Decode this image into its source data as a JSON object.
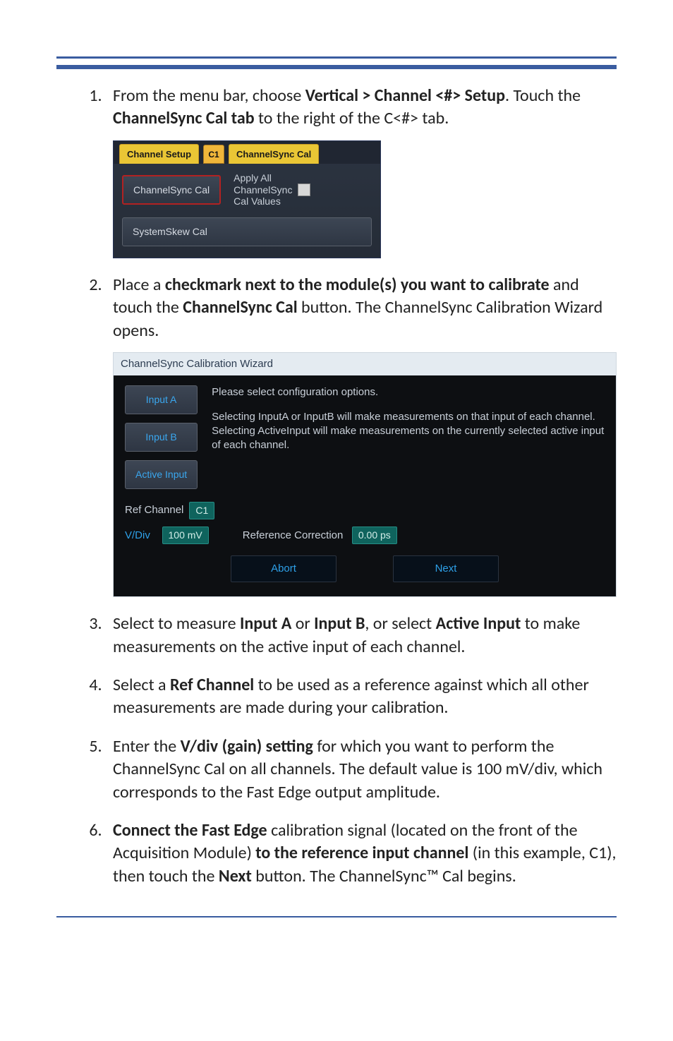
{
  "step1": {
    "prefix": "From the menu bar, choose ",
    "bold1": "Vertical > Channel <#> Setup",
    "mid": ". Touch the ",
    "bold2": "ChannelSync Cal tab",
    "suffix": " to the right of the C<#> tab."
  },
  "shot1": {
    "tab_channel_setup": "Channel Setup",
    "tab_c1": "C1",
    "tab_cscal": "ChannelSync Cal",
    "btn_cscal": "ChannelSync Cal",
    "chk_label1": "Apply All",
    "chk_label2": "ChannelSync",
    "chk_label3": "Cal Values",
    "btn_syscal": "SystemSkew Cal"
  },
  "step2": {
    "prefix": "Place a ",
    "bold1": "checkmark next to the module(s) you want to calibrate",
    "mid1": " and touch the ",
    "bold2": "ChannelSync Cal",
    "suffix": " button. The ChannelSync Calibration Wizard opens."
  },
  "shot2": {
    "title": "ChannelSync Calibration Wizard",
    "btn_input_a": "Input A",
    "btn_input_b": "Input B",
    "btn_active_input": "Active Input",
    "txt_line1": "Please select configuration options.",
    "txt_line2": "Selecting InputA or InputB will make measurements on that input of each channel.",
    "txt_line3": "Selecting ActiveInput will make measurements on the currently selected active input of each channel.",
    "ref_channel_label": "Ref Channel",
    "ref_channel_value": "C1",
    "vdiv_label": "V/Div",
    "vdiv_value": "100 mV",
    "refcorr_label": "Reference Correction",
    "refcorr_value": "0.00 ps",
    "btn_abort": "Abort",
    "btn_next": "Next"
  },
  "step3": {
    "prefix": "Select to measure ",
    "bold1": "Input A",
    "mid1": " or ",
    "bold2": "Input B",
    "mid2": ", or select ",
    "bold3": "Active Input",
    "suffix": " to make measurements on the active input of each channel."
  },
  "step4": {
    "prefix": "Select a ",
    "bold1": "Ref Channel",
    "suffix": " to be used as a reference against which all other measurements are made during your calibration."
  },
  "step5": {
    "prefix": "Enter the ",
    "bold1": "V/div (gain) setting",
    "suffix": " for which you want to perform the ChannelSync Cal on all channels.  The default value is 100 mV/div, which corresponds to the Fast Edge output amplitude."
  },
  "step6": {
    "bold1": "Connect the Fast Edge",
    "mid1": " calibration signal (located on the front of the Acquisition Module) ",
    "bold2": "to the reference input channel",
    "mid2": " (in this example, C1), then touch the ",
    "bold3": "Next",
    "suffix": " button. The ChannelSync™ Cal begins."
  }
}
